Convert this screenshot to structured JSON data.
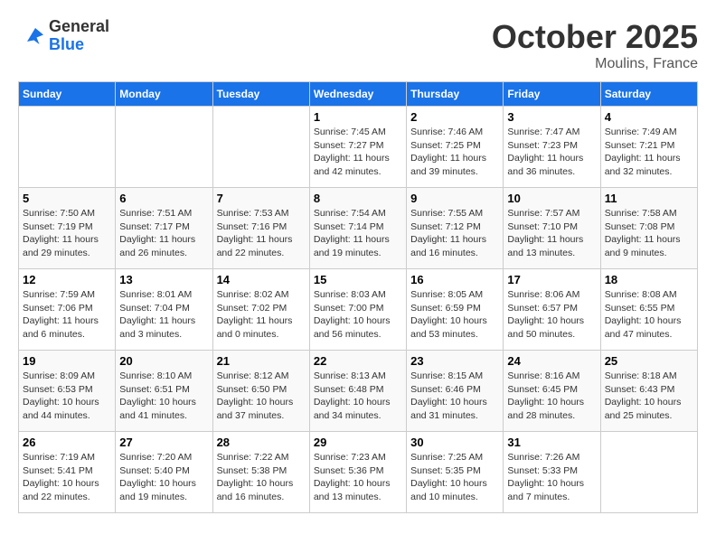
{
  "header": {
    "logo": {
      "general": "General",
      "blue": "Blue"
    },
    "title": "October 2025",
    "location": "Moulins, France"
  },
  "weekdays": [
    "Sunday",
    "Monday",
    "Tuesday",
    "Wednesday",
    "Thursday",
    "Friday",
    "Saturday"
  ],
  "weeks": [
    [
      {
        "day": "",
        "info": ""
      },
      {
        "day": "",
        "info": ""
      },
      {
        "day": "",
        "info": ""
      },
      {
        "day": "1",
        "info": "Sunrise: 7:45 AM\nSunset: 7:27 PM\nDaylight: 11 hours and 42 minutes."
      },
      {
        "day": "2",
        "info": "Sunrise: 7:46 AM\nSunset: 7:25 PM\nDaylight: 11 hours and 39 minutes."
      },
      {
        "day": "3",
        "info": "Sunrise: 7:47 AM\nSunset: 7:23 PM\nDaylight: 11 hours and 36 minutes."
      },
      {
        "day": "4",
        "info": "Sunrise: 7:49 AM\nSunset: 7:21 PM\nDaylight: 11 hours and 32 minutes."
      }
    ],
    [
      {
        "day": "5",
        "info": "Sunrise: 7:50 AM\nSunset: 7:19 PM\nDaylight: 11 hours and 29 minutes."
      },
      {
        "day": "6",
        "info": "Sunrise: 7:51 AM\nSunset: 7:17 PM\nDaylight: 11 hours and 26 minutes."
      },
      {
        "day": "7",
        "info": "Sunrise: 7:53 AM\nSunset: 7:16 PM\nDaylight: 11 hours and 22 minutes."
      },
      {
        "day": "8",
        "info": "Sunrise: 7:54 AM\nSunset: 7:14 PM\nDaylight: 11 hours and 19 minutes."
      },
      {
        "day": "9",
        "info": "Sunrise: 7:55 AM\nSunset: 7:12 PM\nDaylight: 11 hours and 16 minutes."
      },
      {
        "day": "10",
        "info": "Sunrise: 7:57 AM\nSunset: 7:10 PM\nDaylight: 11 hours and 13 minutes."
      },
      {
        "day": "11",
        "info": "Sunrise: 7:58 AM\nSunset: 7:08 PM\nDaylight: 11 hours and 9 minutes."
      }
    ],
    [
      {
        "day": "12",
        "info": "Sunrise: 7:59 AM\nSunset: 7:06 PM\nDaylight: 11 hours and 6 minutes."
      },
      {
        "day": "13",
        "info": "Sunrise: 8:01 AM\nSunset: 7:04 PM\nDaylight: 11 hours and 3 minutes."
      },
      {
        "day": "14",
        "info": "Sunrise: 8:02 AM\nSunset: 7:02 PM\nDaylight: 11 hours and 0 minutes."
      },
      {
        "day": "15",
        "info": "Sunrise: 8:03 AM\nSunset: 7:00 PM\nDaylight: 10 hours and 56 minutes."
      },
      {
        "day": "16",
        "info": "Sunrise: 8:05 AM\nSunset: 6:59 PM\nDaylight: 10 hours and 53 minutes."
      },
      {
        "day": "17",
        "info": "Sunrise: 8:06 AM\nSunset: 6:57 PM\nDaylight: 10 hours and 50 minutes."
      },
      {
        "day": "18",
        "info": "Sunrise: 8:08 AM\nSunset: 6:55 PM\nDaylight: 10 hours and 47 minutes."
      }
    ],
    [
      {
        "day": "19",
        "info": "Sunrise: 8:09 AM\nSunset: 6:53 PM\nDaylight: 10 hours and 44 minutes."
      },
      {
        "day": "20",
        "info": "Sunrise: 8:10 AM\nSunset: 6:51 PM\nDaylight: 10 hours and 41 minutes."
      },
      {
        "day": "21",
        "info": "Sunrise: 8:12 AM\nSunset: 6:50 PM\nDaylight: 10 hours and 37 minutes."
      },
      {
        "day": "22",
        "info": "Sunrise: 8:13 AM\nSunset: 6:48 PM\nDaylight: 10 hours and 34 minutes."
      },
      {
        "day": "23",
        "info": "Sunrise: 8:15 AM\nSunset: 6:46 PM\nDaylight: 10 hours and 31 minutes."
      },
      {
        "day": "24",
        "info": "Sunrise: 8:16 AM\nSunset: 6:45 PM\nDaylight: 10 hours and 28 minutes."
      },
      {
        "day": "25",
        "info": "Sunrise: 8:18 AM\nSunset: 6:43 PM\nDaylight: 10 hours and 25 minutes."
      }
    ],
    [
      {
        "day": "26",
        "info": "Sunrise: 7:19 AM\nSunset: 5:41 PM\nDaylight: 10 hours and 22 minutes."
      },
      {
        "day": "27",
        "info": "Sunrise: 7:20 AM\nSunset: 5:40 PM\nDaylight: 10 hours and 19 minutes."
      },
      {
        "day": "28",
        "info": "Sunrise: 7:22 AM\nSunset: 5:38 PM\nDaylight: 10 hours and 16 minutes."
      },
      {
        "day": "29",
        "info": "Sunrise: 7:23 AM\nSunset: 5:36 PM\nDaylight: 10 hours and 13 minutes."
      },
      {
        "day": "30",
        "info": "Sunrise: 7:25 AM\nSunset: 5:35 PM\nDaylight: 10 hours and 10 minutes."
      },
      {
        "day": "31",
        "info": "Sunrise: 7:26 AM\nSunset: 5:33 PM\nDaylight: 10 hours and 7 minutes."
      },
      {
        "day": "",
        "info": ""
      }
    ]
  ]
}
